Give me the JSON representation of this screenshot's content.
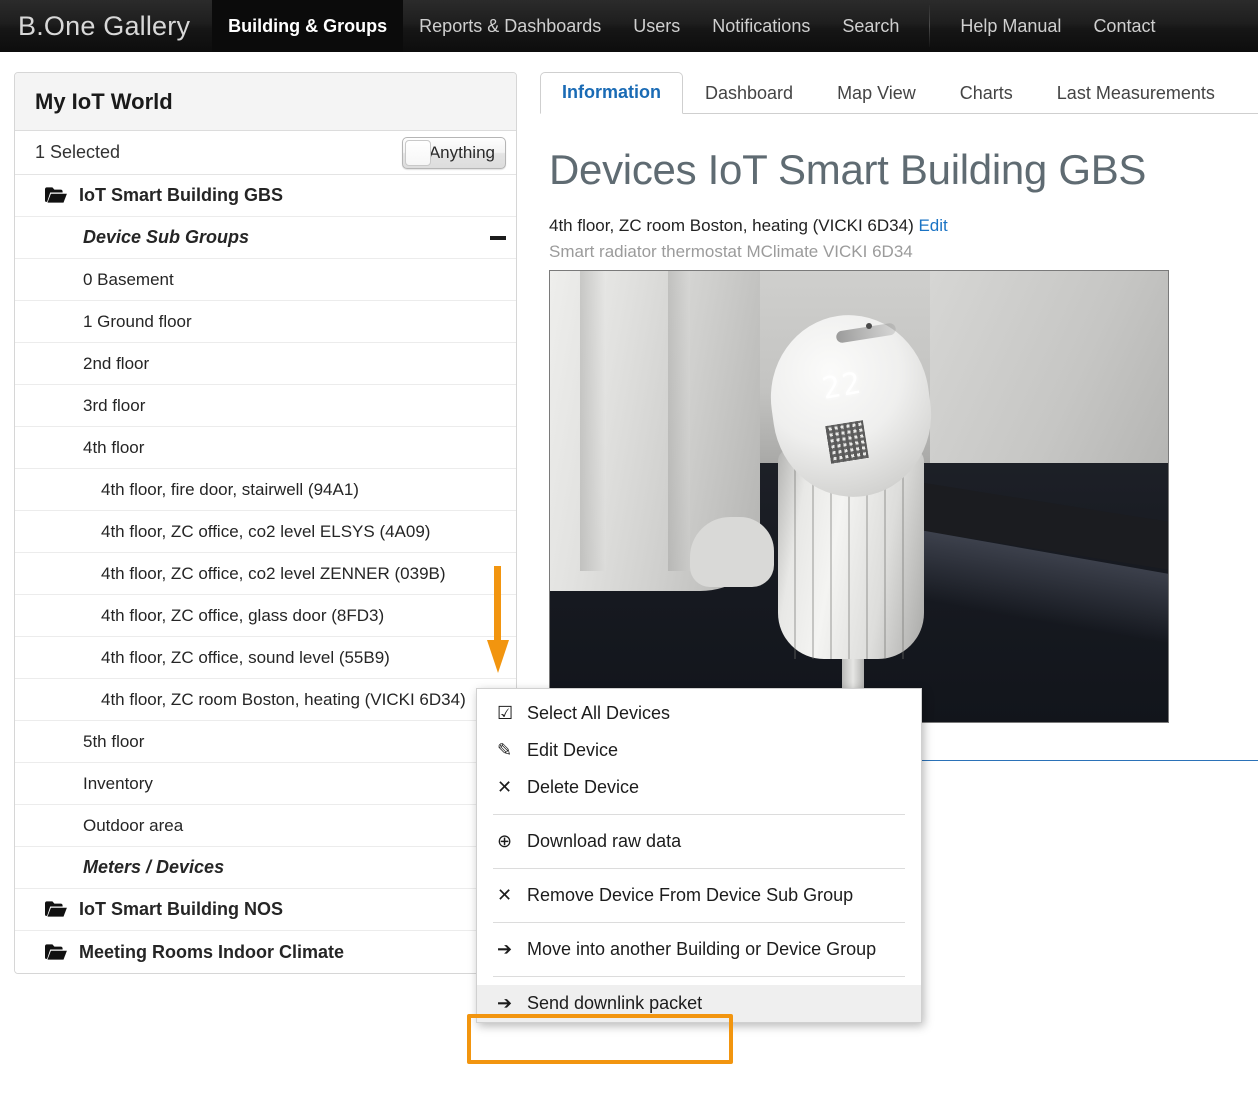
{
  "topnav": {
    "brand": "B.One Gallery",
    "items": [
      {
        "label": "Building & Groups",
        "active": true
      },
      {
        "label": "Reports & Dashboards",
        "active": false
      },
      {
        "label": "Users",
        "active": false
      },
      {
        "label": "Notifications",
        "active": false
      },
      {
        "label": "Search",
        "active": false
      }
    ],
    "right_items": [
      {
        "label": "Help Manual"
      },
      {
        "label": "Contact"
      }
    ]
  },
  "sidebar": {
    "title": "My IoT World",
    "selected_text": "1 Selected",
    "filter_toggle": {
      "label": "Anything",
      "state": "off"
    },
    "tree": [
      {
        "label": "IoT Smart Building GBS",
        "level": "building",
        "icon": "folder-open-icon"
      },
      {
        "label": "Device Sub Groups",
        "level": "section",
        "collapse_icon": "minus-icon"
      },
      {
        "label": "0 Basement",
        "level": "floor"
      },
      {
        "label": "1 Ground floor",
        "level": "floor"
      },
      {
        "label": "2nd floor",
        "level": "floor"
      },
      {
        "label": "3rd floor",
        "level": "floor"
      },
      {
        "label": "4th floor",
        "level": "floor"
      },
      {
        "label": "4th floor, fire door, stairwell (94A1)",
        "level": "device"
      },
      {
        "label": "4th floor, ZC office, co2 level ELSYS (4A09)",
        "level": "device"
      },
      {
        "label": "4th floor, ZC office, co2 level ZENNER (039B)",
        "level": "device"
      },
      {
        "label": "4th floor, ZC office, glass door (8FD3)",
        "level": "device"
      },
      {
        "label": "4th floor, ZC office, sound level (55B9)",
        "level": "device"
      },
      {
        "label": "4th floor, ZC room Boston, heating (VICKI 6D34)",
        "level": "device"
      },
      {
        "label": "5th floor",
        "level": "floor"
      },
      {
        "label": "Inventory",
        "level": "floor"
      },
      {
        "label": "Outdoor area",
        "level": "floor"
      },
      {
        "label": "Meters / Devices",
        "level": "section"
      },
      {
        "label": "IoT Smart Building NOS",
        "level": "building",
        "icon": "folder-open-icon"
      },
      {
        "label": "Meeting Rooms Indoor Climate",
        "level": "building",
        "icon": "folder-open-icon"
      }
    ]
  },
  "main": {
    "tabs": [
      {
        "label": "Information",
        "active": true
      },
      {
        "label": "Dashboard",
        "active": false
      },
      {
        "label": "Map View",
        "active": false
      },
      {
        "label": "Charts",
        "active": false
      },
      {
        "label": "Last Measurements",
        "active": false
      }
    ],
    "page_title": "Devices IoT Smart Building GBS",
    "subtitle": "4th floor, ZC room Boston, heating (VICKI 6D34)",
    "edit_link": "Edit",
    "device_description": "Smart radiator thermostat MClimate VICKI 6D34",
    "photo": {
      "alt": "Smart radiator thermostat mounted on a radiator",
      "display_value": "22"
    }
  },
  "context_menu": {
    "items": [
      {
        "label": "Select All Devices",
        "icon": "checkbox-checked-icon",
        "glyph": "☑",
        "hover": false
      },
      {
        "label": "Edit Device",
        "icon": "pencil-icon",
        "glyph": "✎",
        "hover": false
      },
      {
        "label": "Delete Device",
        "icon": "close-x-icon",
        "glyph": "✕",
        "hover": false
      },
      {
        "separator": true
      },
      {
        "label": "Download raw data",
        "icon": "download-circle-icon",
        "glyph": "⊕",
        "hover": false
      },
      {
        "separator": true
      },
      {
        "label": "Remove Device From Device Sub Group",
        "icon": "close-x-icon",
        "glyph": "✕",
        "hover": false
      },
      {
        "separator": true
      },
      {
        "label": "Move into another Building or Device Group",
        "icon": "arrow-right-icon",
        "glyph": "➔",
        "hover": false
      },
      {
        "separator": true
      },
      {
        "label": "Send downlink packet",
        "icon": "arrow-right-icon",
        "glyph": "➔",
        "hover": true,
        "highlighted": true
      }
    ]
  },
  "annotations": {
    "arrow_color": "#f2950f",
    "highlight_color": "#f2950f"
  },
  "colors": {
    "accent_blue": "#1a6bb5",
    "rule_blue": "#2b72b8",
    "nav_bg": "#1b1b1b",
    "orange": "#f2950f"
  }
}
